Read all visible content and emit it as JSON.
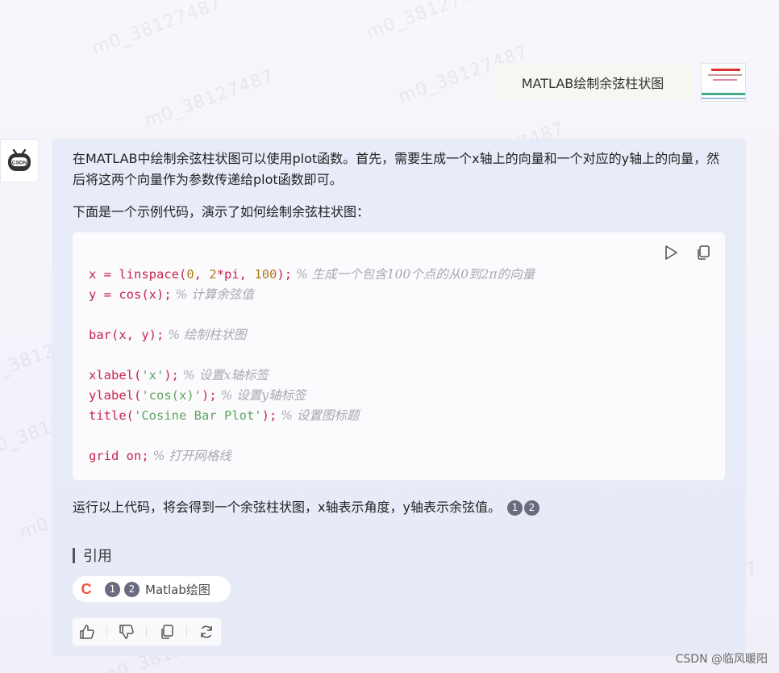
{
  "watermark_text": "m0_38127487",
  "user_message": "MATLAB绘制余弦柱状图",
  "reply": {
    "paragraph_1": "在MATLAB中绘制余弦柱状图可以使用plot函数。首先，需要生成一个x轴上的向量和一个对应的y轴上的向量，然后将这两个向量作为参数传递给plot函数即可。",
    "paragraph_2": "下面是一个示例代码，演示了如何绘制余弦柱状图：",
    "code": {
      "line1_code_a": "x = linspace(",
      "line1_n0": "0",
      "line1_mid": ", ",
      "line1_n2": "2",
      "line1_mul": "*pi, ",
      "line1_n100": "100",
      "line1_end": ");",
      "line1_comment": " % 生成一个包含100个点的从0到2π的向量",
      "line2_code": "y = cos(x);",
      "line2_comment": " % 计算余弦值",
      "line3_code": "bar(x, y);",
      "line3_comment": " % 绘制柱状图",
      "line4_a": "xlabel(",
      "line4_str": "'x'",
      "line4_b": ");",
      "line4_comment": " % 设置x轴标签",
      "line5_a": "ylabel(",
      "line5_str": "'cos(x)'",
      "line5_b": ");",
      "line5_comment": " % 设置y轴标签",
      "line6_a": "title(",
      "line6_str": "'Cosine Bar Plot'",
      "line6_b": ");",
      "line6_comment": " % 设置图标题",
      "line7_code": "grid on;",
      "line7_comment": " % 打开网格线"
    },
    "paragraph_3": "运行以上代码，将会得到一个余弦柱状图，x轴表示角度，y轴表示余弦值。",
    "citations": [
      "1",
      "2"
    ],
    "reference_heading": "引用",
    "reference_chip": {
      "logo": "C",
      "citations": [
        "1",
        "2"
      ],
      "label": "Matlab绘图"
    }
  },
  "footer_brand": "CSDN @临风暖阳",
  "colors": {
    "accent_logo": "#f0503c",
    "cite_badge": "#6b6b80",
    "reply_bg": "#e8ecf8"
  },
  "icons": [
    "play-icon",
    "copy-icon",
    "thumbs-up-icon",
    "thumbs-down-icon",
    "copy-answer-icon",
    "regenerate-icon",
    "bot-icon"
  ]
}
